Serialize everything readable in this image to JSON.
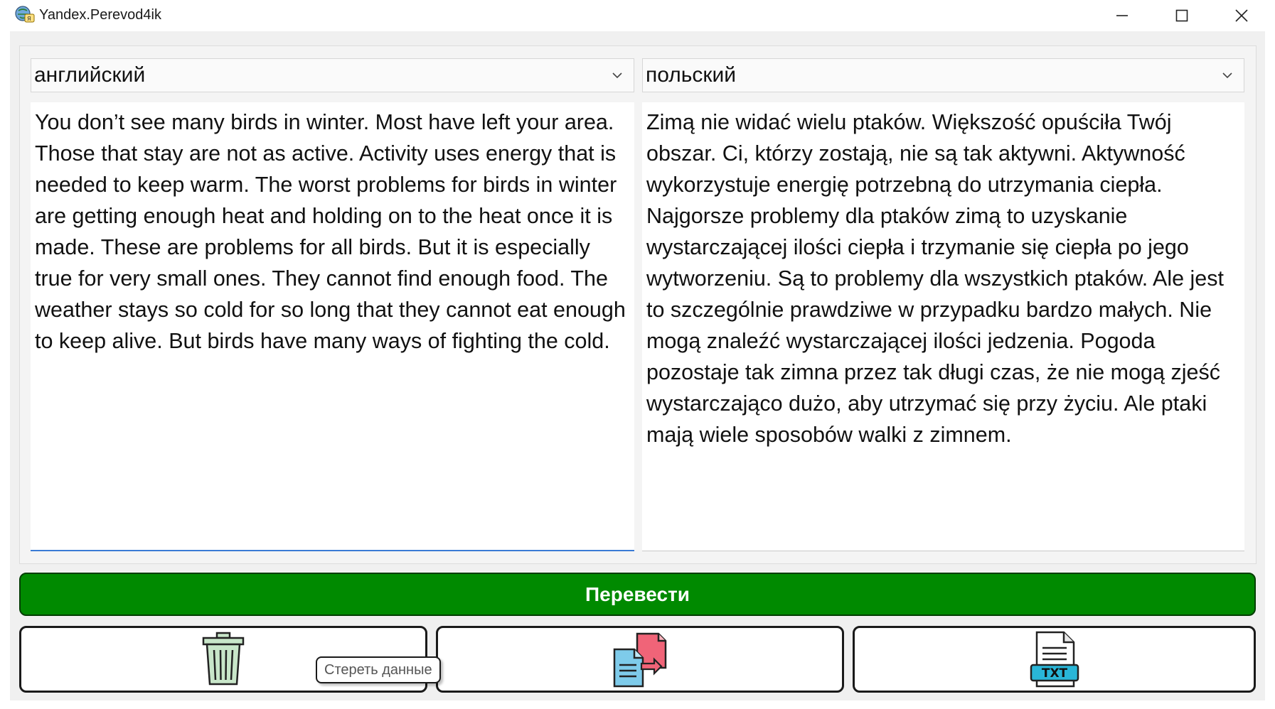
{
  "window": {
    "title": "Yandex.Perevod4ik",
    "icon": "translator-app-icon",
    "controls": [
      "minimize-icon",
      "maximize-icon",
      "close-icon"
    ]
  },
  "source": {
    "language": "английский",
    "text": "You don’t see many birds in winter. Most have left your area. Those that stay are not as active. Activity uses energy that is needed to keep warm. The worst problems for birds in winter are getting enough heat and holding on to the heat once it is made. These are problems for all birds. But it is especially true for very small ones. They cannot find enough food. The weather stays so cold for so long that they cannot eat enough to keep alive. But birds have many ways of fighting the cold."
  },
  "target": {
    "language": "польский",
    "text": "Zimą nie widać wielu ptaków. Większość opuściła Twój obszar. Ci, którzy zostają, nie są tak aktywni. Aktywność wykorzystuje energię potrzebną do utrzymania ciepła. Najgorsze problemy dla ptaków zimą to uzyskanie wystarczającej ilości ciepła i trzymanie się ciepła po jego wytworzeniu. Są to problemy dla wszystkich ptaków. Ale jest to szczególnie prawdziwe w przypadku bardzo małych. Nie mogą znaleźć wystarczającej ilości jedzenia. Pogoda pozostaje tak zimna przez tak długi czas, że nie mogą zjeść wystarczająco dużo, aby utrzymać się przy życiu. Ale ptaki mają wiele sposobów walki z zimnem."
  },
  "actions": {
    "translate_label": "Перевести",
    "clear_tooltip": "Стереть данные",
    "clear_icon": "trash-icon",
    "swap_icon": "swap-documents-icon",
    "save_icon": "txt-file-icon",
    "save_icon_label": "TXT"
  },
  "colors": {
    "translate_button": "#008a00",
    "accent_border": "#3a7bd5"
  }
}
